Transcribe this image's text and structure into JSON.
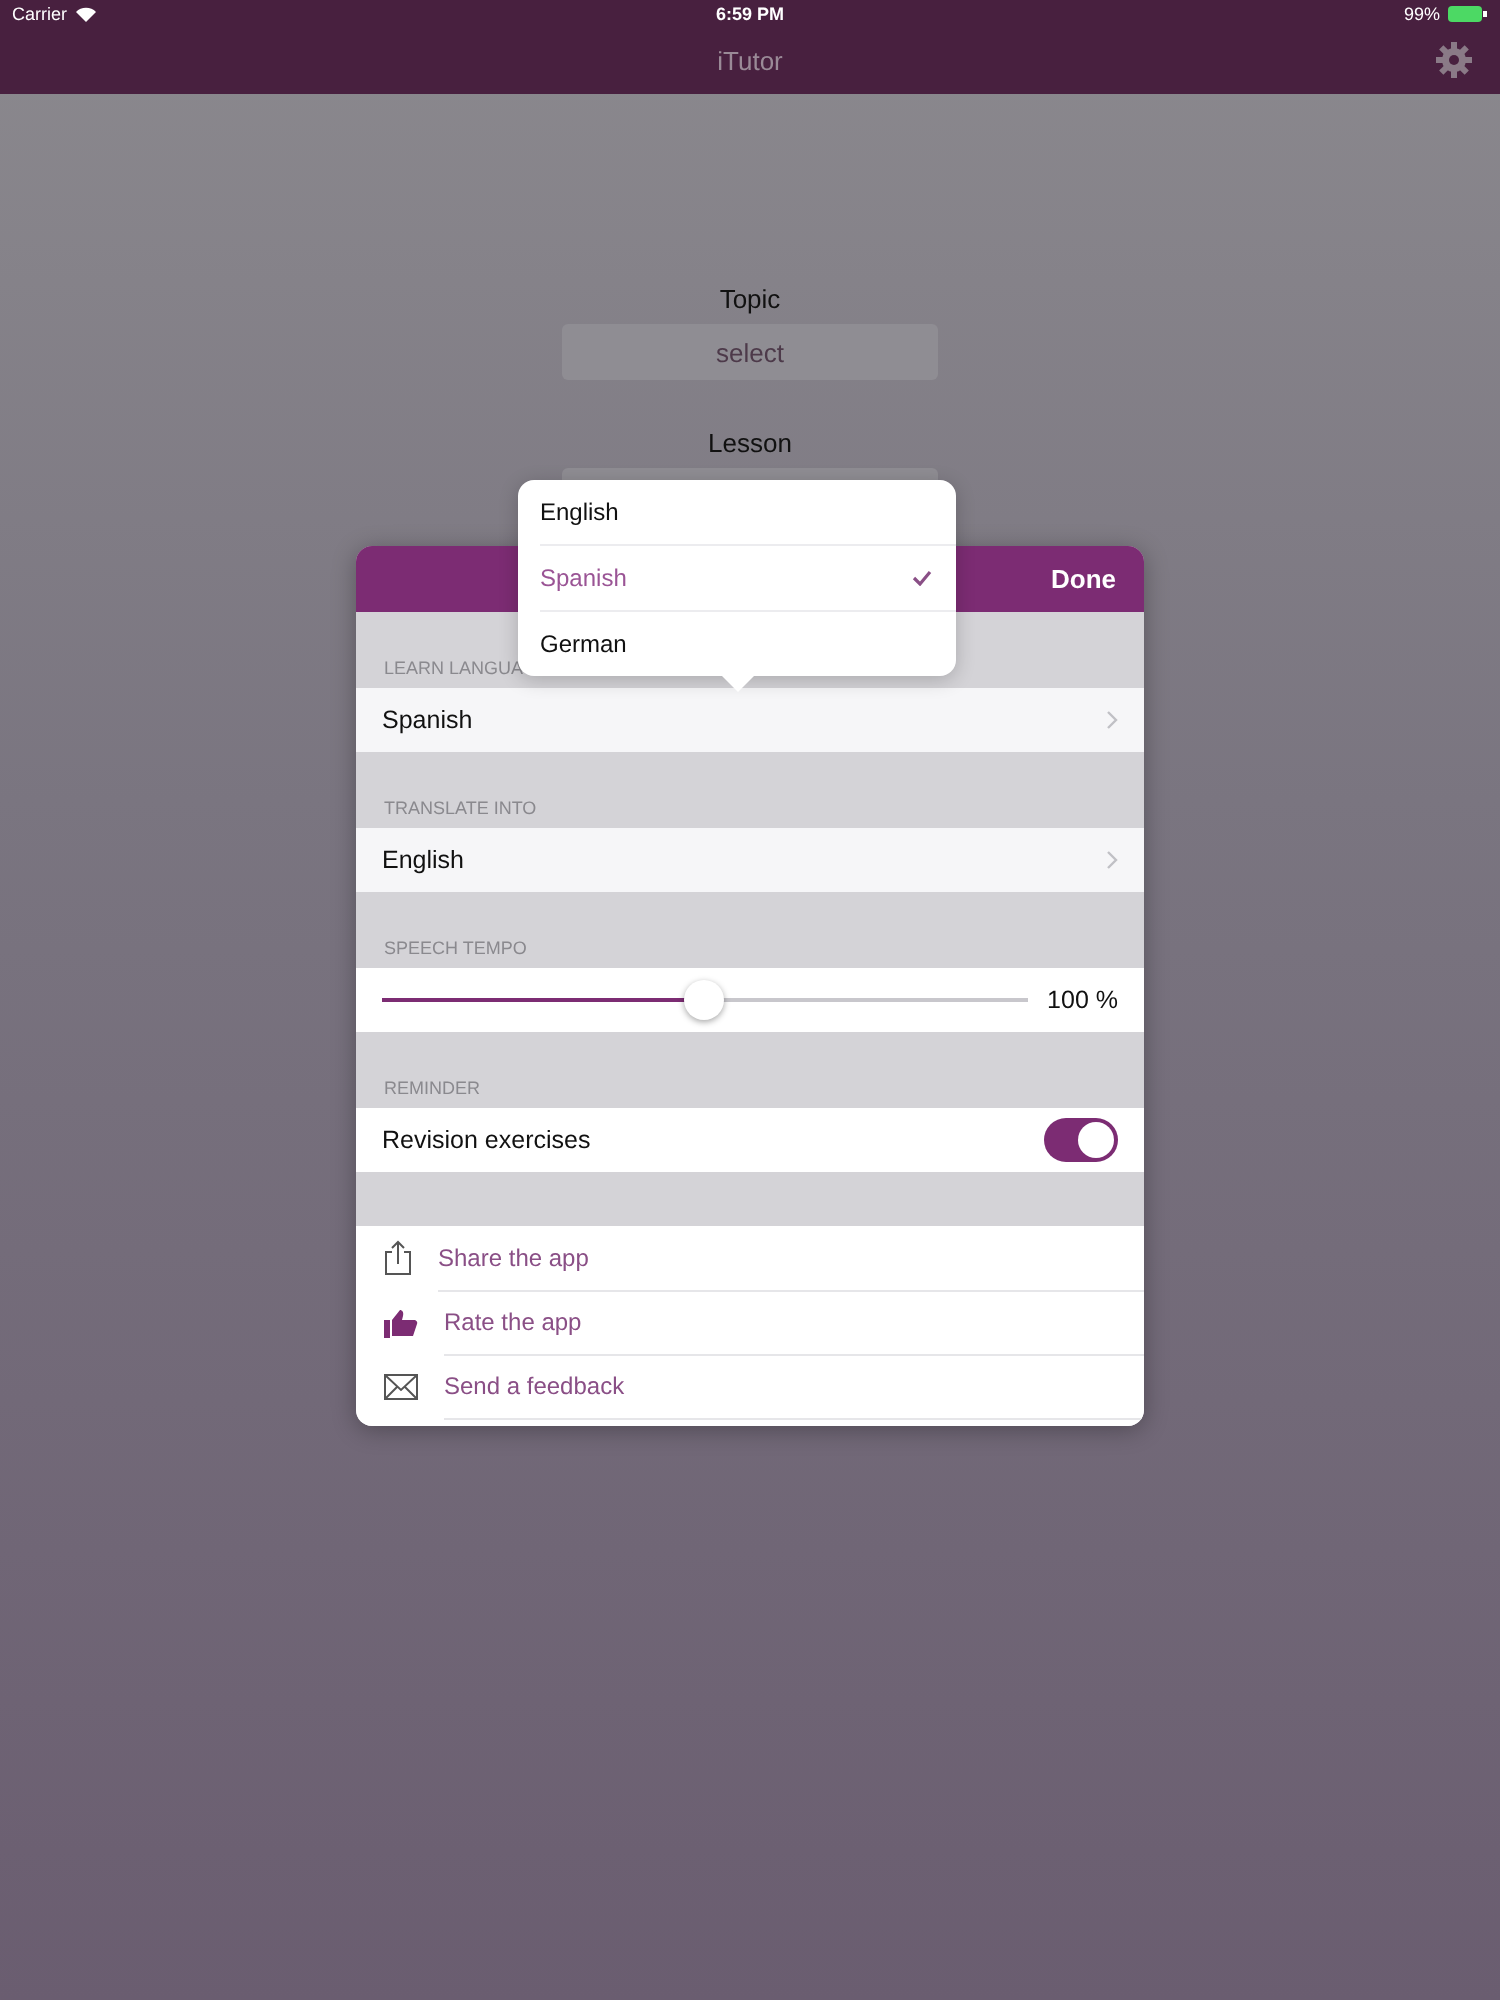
{
  "status_bar": {
    "carrier": "Carrier",
    "time": "6:59 PM",
    "battery": "99%"
  },
  "nav_bar": {
    "title": "iTutor"
  },
  "form": [
    {
      "label": "Topic",
      "placeholder": "select"
    },
    {
      "label": "Lesson"
    }
  ],
  "settings": {
    "done": "Done",
    "sections": [
      {
        "kind": "picker",
        "header": "LEARN LANGUA",
        "value": "Spanish"
      },
      {
        "kind": "picker",
        "header": "TRANSLATE INTO",
        "value": "English"
      },
      {
        "kind": "slider",
        "header": "SPEECH TEMPO",
        "level": 0.5,
        "reading": "100 %"
      },
      {
        "kind": "toggle",
        "header": "REMINDER",
        "label": "Revision exercises",
        "on": true
      }
    ],
    "actions": [
      {
        "kind": "share",
        "label": "Share the app"
      },
      {
        "kind": "rate",
        "label": "Rate the app"
      },
      {
        "kind": "mail",
        "label": "Send a feedback"
      }
    ]
  },
  "language_menu": [
    {
      "label": "English",
      "selected": false
    },
    {
      "label": "Spanish",
      "selected": true
    },
    {
      "label": "German",
      "selected": false
    }
  ]
}
